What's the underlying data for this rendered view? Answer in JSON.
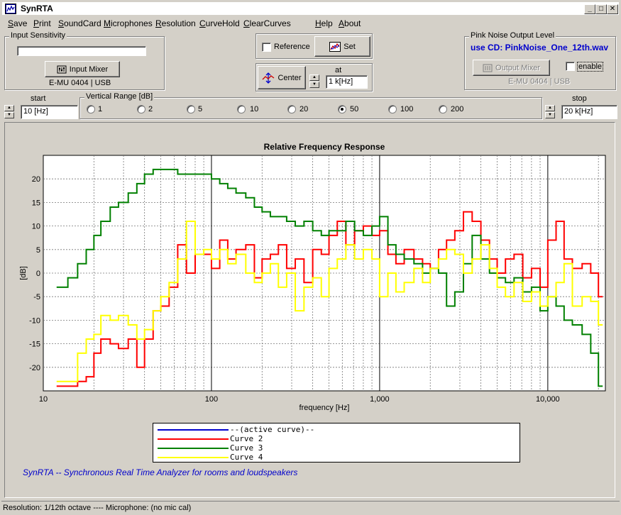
{
  "window": {
    "title": "SynRTA",
    "controls": [
      "_",
      "□",
      "✕"
    ]
  },
  "menu": [
    "Save",
    "Print",
    "SoundCard",
    "Microphones",
    "Resolution",
    "CurveHold",
    "ClearCurves",
    "Help",
    "About"
  ],
  "input_sensitivity": {
    "legend": "Input Sensitivity",
    "mixer_button": "Input Mixer",
    "device": "E-MU 0404 | USB"
  },
  "reference": {
    "checkbox_label": "Reference",
    "set_button": "Set",
    "center_button": "Center",
    "at_label": "at",
    "at_value": "1 k[Hz]"
  },
  "pink_noise": {
    "legend": "Pink Noise Output Level",
    "file": "use CD:  PinkNoise_One_12th.wav",
    "mixer_button": "Output Mixer",
    "enable_label": "enable",
    "device": "E-MU 0404 | USB"
  },
  "start": {
    "label": "start",
    "value": "10 [Hz]"
  },
  "stop": {
    "label": "stop",
    "value": "20 k[Hz]"
  },
  "vertical_range": {
    "legend": "Vertical Range [dB]",
    "options": [
      "1",
      "2",
      "5",
      "10",
      "20",
      "50",
      "100",
      "200"
    ],
    "selected": "50"
  },
  "colors": {
    "active": "#0000cc",
    "curve2": "#ff0000",
    "curve3": "#008000",
    "curve4": "#ffff00",
    "footer": "#0000cc"
  },
  "chart_data": {
    "type": "line",
    "title": "Relative Frequency Response",
    "xlabel": "frequency [Hz]",
    "ylabel": "[dB]",
    "xscale": "log",
    "xlim": [
      10,
      22000
    ],
    "ylim": [
      -25,
      25
    ],
    "xticks": [
      10,
      100,
      1000,
      10000
    ],
    "xtick_labels": [
      "10",
      "100",
      "1,000",
      "10,000"
    ],
    "yticks": [
      -20,
      -15,
      -10,
      -5,
      0,
      5,
      10,
      15,
      20
    ],
    "grid": true,
    "series": [
      {
        "name": "--(active curve)--",
        "color": "#0000cc",
        "x": [],
        "y": []
      },
      {
        "name": "Curve 2",
        "color": "#ff0000",
        "x": [
          12,
          14,
          16,
          18,
          20,
          22,
          25,
          28,
          32,
          36,
          40,
          45,
          50,
          56,
          63,
          71,
          80,
          90,
          100,
          112,
          125,
          140,
          160,
          180,
          200,
          224,
          250,
          280,
          315,
          355,
          400,
          450,
          500,
          560,
          630,
          710,
          800,
          900,
          1000,
          1120,
          1250,
          1400,
          1600,
          1800,
          2000,
          2240,
          2500,
          2800,
          3150,
          3550,
          4000,
          4500,
          5000,
          5600,
          6300,
          7100,
          8000,
          9000,
          10000,
          11200,
          12500,
          14000,
          16000,
          18000,
          20000
        ],
        "y": [
          -24,
          -24,
          -23,
          -22,
          -17,
          -14,
          -15,
          -16,
          -14,
          -20,
          -14,
          -8,
          -7,
          -3,
          6,
          0,
          4,
          4,
          1,
          7,
          3,
          5,
          6,
          -1,
          3,
          4,
          6,
          1,
          3,
          -2,
          5,
          4,
          8,
          11,
          6,
          9,
          10,
          8,
          9,
          4,
          2,
          5,
          3,
          2,
          1,
          5,
          7,
          9,
          13,
          11,
          7,
          3,
          0,
          3,
          4,
          -1,
          1,
          -3,
          7,
          11,
          3,
          1,
          2,
          0,
          -5
        ]
      },
      {
        "name": "Curve 3",
        "color": "#008000",
        "x": [
          12,
          14,
          16,
          18,
          20,
          22,
          25,
          28,
          32,
          36,
          40,
          45,
          50,
          56,
          63,
          71,
          80,
          90,
          100,
          112,
          125,
          140,
          160,
          180,
          200,
          224,
          250,
          280,
          315,
          355,
          400,
          450,
          500,
          560,
          630,
          710,
          800,
          900,
          1000,
          1120,
          1250,
          1400,
          1600,
          1800,
          2000,
          2240,
          2500,
          2800,
          3150,
          3550,
          4000,
          4500,
          5000,
          5600,
          6300,
          7100,
          8000,
          9000,
          10000,
          11200,
          12500,
          14000,
          16000,
          18000,
          20000
        ],
        "y": [
          -3,
          -1,
          2,
          5,
          8,
          11,
          14,
          15,
          17,
          19,
          21,
          22,
          22,
          22,
          21,
          21,
          21,
          21,
          20,
          19,
          18,
          17,
          16,
          14,
          13,
          12,
          12,
          11,
          10,
          11,
          9,
          8,
          9,
          9,
          11,
          9,
          8,
          10,
          12,
          6,
          4,
          3,
          2,
          0,
          1,
          0,
          -7,
          -4,
          2,
          8,
          3,
          0,
          -1,
          -2,
          -1,
          -4,
          -3,
          -8,
          -5,
          -7,
          -10,
          -11,
          -13,
          -17,
          -24
        ]
      },
      {
        "name": "Curve 4",
        "color": "#ffff00",
        "x": [
          12,
          14,
          16,
          18,
          20,
          22,
          25,
          28,
          32,
          36,
          40,
          45,
          50,
          56,
          63,
          71,
          80,
          90,
          100,
          112,
          125,
          140,
          160,
          180,
          200,
          224,
          250,
          280,
          315,
          355,
          400,
          450,
          500,
          560,
          630,
          710,
          800,
          900,
          1000,
          1120,
          1250,
          1400,
          1600,
          1800,
          2000,
          2240,
          2500,
          2800,
          3150,
          3550,
          4000,
          4500,
          5000,
          5600,
          6300,
          7100,
          8000,
          9000,
          10000,
          11200,
          12500,
          14000,
          16000,
          18000,
          20000
        ],
        "y": [
          -23,
          -23,
          -17,
          -14,
          -13,
          -9,
          -10,
          -9,
          -11,
          -14,
          -12,
          -8,
          -5,
          -2,
          3,
          11,
          4,
          5,
          3,
          5,
          2,
          4,
          0,
          -2,
          0,
          2,
          -3,
          0,
          -8,
          -3,
          -1,
          -5,
          1,
          3,
          6,
          3,
          5,
          3,
          -5,
          0,
          -4,
          -2,
          1,
          -2,
          1,
          3,
          5,
          4,
          0,
          3,
          6,
          1,
          -3,
          -5,
          -2,
          -6,
          -4,
          -7,
          -5,
          -2,
          2,
          -7,
          -5,
          -6,
          -11
        ]
      }
    ]
  },
  "footer": "SynRTA -- Synchronous Real Time Analyzer for rooms and loudspeakers",
  "status": "Resolution: 1/12th octave  ----  Microphone: (no mic cal)"
}
